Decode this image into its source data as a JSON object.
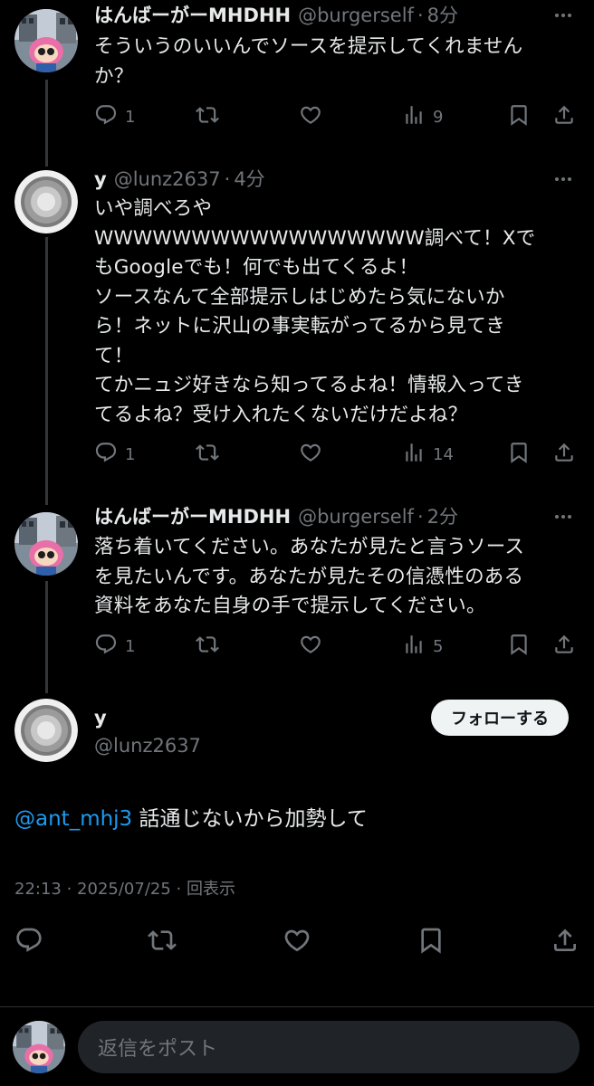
{
  "tweets": [
    {
      "name": "はんばーがーMHDHH",
      "handle": "@burgerself",
      "time": "8分",
      "text": "そういうのいいんでソースを提示してくれません\nか？",
      "replies": "1",
      "retweets": "",
      "likes": "",
      "views": "9"
    },
    {
      "name": "y",
      "handle": "@lunz2637",
      "time": "4分",
      "text": "いや調べろや\nWWWWWWWWWWWWWWWWW調べて！Xで\nもGoogleでも！何でも出てくるよ！\nソースなんて全部提示しはじめたら気にないか\nら！ネットに沢山の事実転がってるから見てき\nて！\nてかニュジ好きなら知ってるよね！情報入ってき\nてるよね？受け入れたくないだけだよね？",
      "replies": "1",
      "retweets": "",
      "likes": "",
      "views": "14"
    },
    {
      "name": "はんばーがーMHDHH",
      "handle": "@burgerself",
      "time": "2分",
      "text": "落ち着いてください。あなたが見たと言うソース\nを見たいんです。あなたが見たその信憑性のある\n資料をあなた自身の手で提示してください。",
      "replies": "1",
      "retweets": "",
      "likes": "",
      "views": "5"
    }
  ],
  "main_tweet": {
    "name": "y",
    "handle": "@lunz2637",
    "follow_label": "フォローする",
    "mention": "@ant_mhj3",
    "text": " 話通じないから加勢して",
    "timestamp": "22:13 · 2025/07/25 · 回表示"
  },
  "reply_box": {
    "placeholder": "返信をポスト"
  },
  "icons": {
    "reply": "reply-icon",
    "retweet": "retweet-icon",
    "like": "like-icon",
    "views": "views-icon",
    "bookmark": "bookmark-icon",
    "share": "share-icon",
    "more": "more-icon"
  }
}
